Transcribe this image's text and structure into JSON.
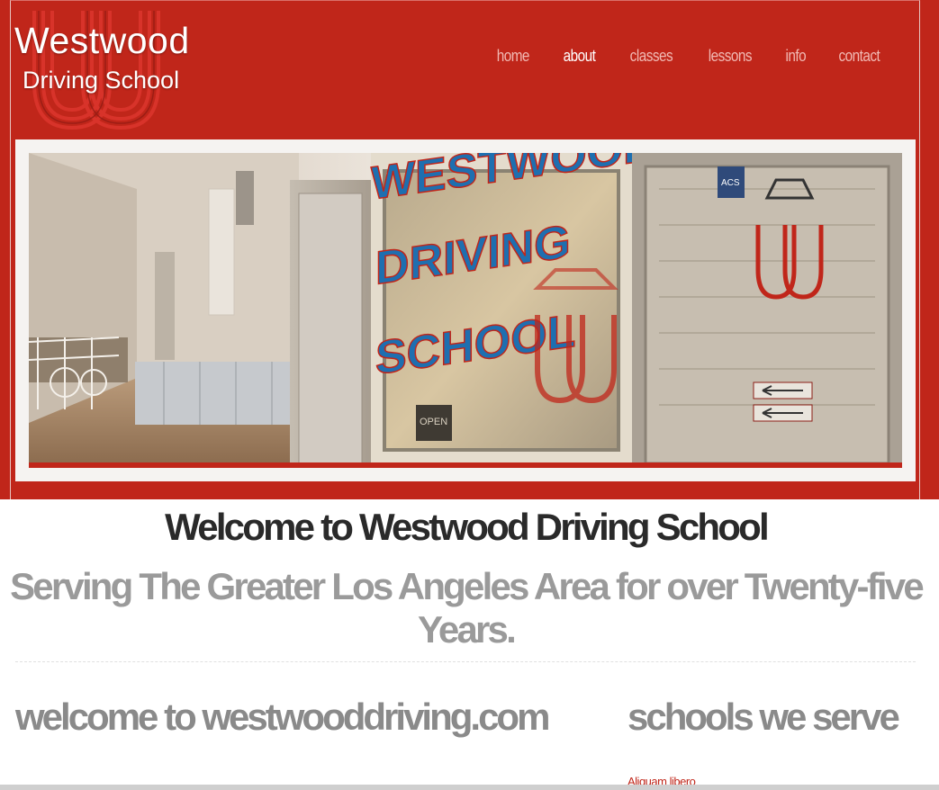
{
  "logo": {
    "title": "Westwood",
    "subtitle": "Driving School",
    "icon": "ww-monogram-icon"
  },
  "nav": {
    "items": [
      {
        "label": "home",
        "active": false
      },
      {
        "label": "about",
        "active": true
      },
      {
        "label": "classes",
        "active": false
      },
      {
        "label": "lessons",
        "active": false
      },
      {
        "label": "info",
        "active": false
      },
      {
        "label": "contact",
        "active": false
      }
    ]
  },
  "banner": {
    "sign_text": [
      "WESTWOOD",
      "DRIVING",
      "SCHOOL"
    ],
    "door_badge": "ACS",
    "door_label": "OPEN"
  },
  "welcome": {
    "title": "Welcome to Westwood Driving School",
    "subtitle": "Serving The Greater Los Angeles Area for over Twenty-five Years."
  },
  "sections": {
    "left_heading": "welcome to westwooddriving.com",
    "right_heading": "schools we serve",
    "school_link": "Aliquam libero"
  },
  "colors": {
    "brand_red": "#c0261a",
    "nav_inactive": "#f1b9b3",
    "nav_active": "#ffffff",
    "heading_gray": "#8a8a8a"
  }
}
